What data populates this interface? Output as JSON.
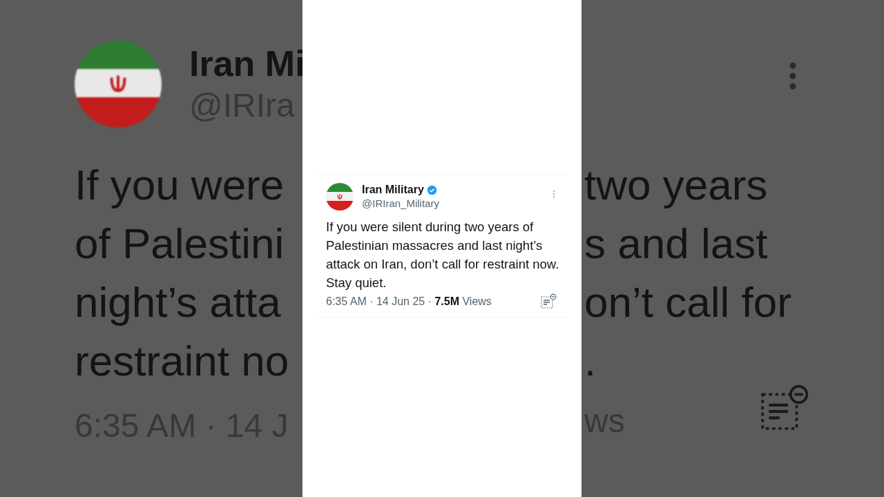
{
  "background_left": {
    "name": "Iran Mi",
    "handle": "@IRIra",
    "lines": [
      "If you were",
      "of Palestini",
      "night’s atta",
      "restraint no"
    ],
    "meta": "6:35 AM · 14 J"
  },
  "background_right": {
    "lines": [
      "two years",
      "s and last",
      "on’t call for",
      "."
    ],
    "meta": "ws"
  },
  "tweet": {
    "name": "Iran Military",
    "verified": true,
    "handle": "@IRIran_Military",
    "text": "If you were silent during two years of Palestinian massacres and last night’s attack on Iran, don’t call for restraint now. Stay quiet.",
    "time": "6:35 AM · 14 Jun 25 · ",
    "views_count": "7.5M",
    "views_label": " Views"
  }
}
